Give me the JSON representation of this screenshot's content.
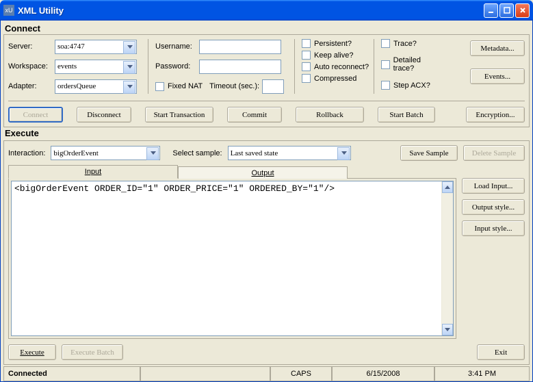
{
  "window": {
    "title": "XML Utility"
  },
  "connect": {
    "title": "Connect",
    "server_label": "Server:",
    "server_value": "soa:4747",
    "workspace_label": "Workspace:",
    "workspace_value": "events",
    "adapter_label": "Adapter:",
    "adapter_value": "ordersQueue",
    "username_label": "Username:",
    "username_value": "",
    "password_label": "Password:",
    "password_value": "",
    "fixed_nat_label": "Fixed NAT",
    "timeout_label": "Timeout (sec.):",
    "timeout_value": "",
    "persistent_label": "Persistent?",
    "keep_alive_label": "Keep alive?",
    "auto_reconnect_label": "Auto reconnect?",
    "compressed_label": "Compressed",
    "trace_label": "Trace?",
    "detailed_trace_label": "Detailed trace?",
    "step_acx_label": "Step ACX?",
    "metadata_btn": "Metadata...",
    "events_btn": "Events...",
    "connect_btn": "Connect",
    "disconnect_btn": "Disconnect",
    "start_txn_btn": "Start Transaction",
    "commit_btn": "Commit",
    "rollback_btn": "Rollback",
    "start_batch_btn": "Start Batch",
    "encryption_btn": "Encryption..."
  },
  "execute": {
    "title": "Execute",
    "interaction_label": "Interaction:",
    "interaction_value": "bigOrderEvent",
    "select_sample_label": "Select sample:",
    "select_sample_value": "Last saved state",
    "save_sample_btn": "Save Sample",
    "delete_sample_btn": "Delete Sample",
    "tab_input": "Input",
    "tab_output": "Output",
    "editor_content": "<bigOrderEvent ORDER_ID=\"1\" ORDER_PRICE=\"1\" ORDERED_BY=\"1\"/>",
    "load_input_btn": "Load Input...",
    "output_style_btn": "Output style...",
    "input_style_btn": "Input style...",
    "execute_btn": "Execute",
    "execute_batch_btn": "Execute Batch",
    "exit_btn": "Exit"
  },
  "status": {
    "connected": "Connected",
    "caps": "CAPS",
    "date": "6/15/2008",
    "time": "3:41 PM"
  }
}
